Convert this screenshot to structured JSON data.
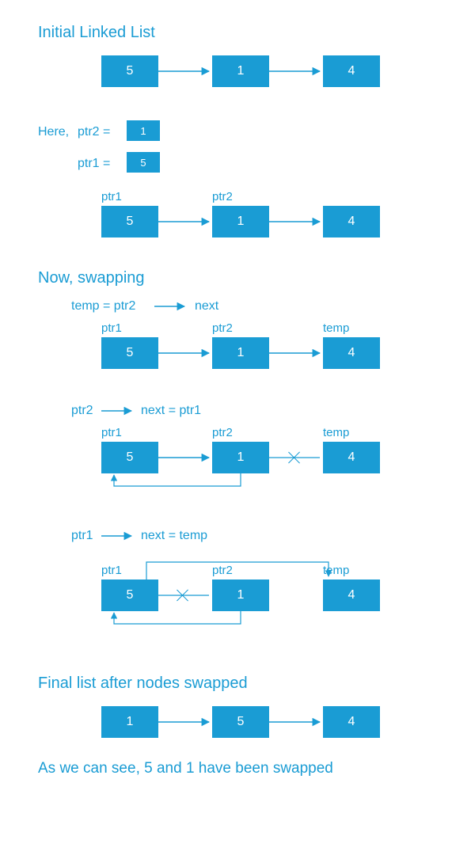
{
  "colors": {
    "accent": "#1a9cd4"
  },
  "heading_initial": "Initial Linked List",
  "here_label": "Here,",
  "ptr2_eq": "ptr2  =",
  "ptr1_eq": "ptr1  =",
  "ptr1_label": "ptr1",
  "ptr2_label": "ptr2",
  "temp_label": "temp",
  "heading_swapping": "Now,   swapping",
  "expr_temp": "temp  =  ptr2",
  "expr_temp_tail": "next",
  "expr_ptr2": "ptr2",
  "expr_ptr2_tail": "next  =  ptr1",
  "expr_ptr1": "ptr1",
  "expr_ptr1_tail": "next  =  temp",
  "heading_final": "Final list after nodes swapped",
  "conclusion": "As we can see,  5 and 1 have been swapped",
  "nodes": {
    "initial": [
      "5",
      "1",
      "4"
    ],
    "small_ptr2": "1",
    "small_ptr1": "5",
    "row_labeled": [
      "5",
      "1",
      "4"
    ],
    "row_temp": [
      "5",
      "1",
      "4"
    ],
    "row_ptr2next": [
      "5",
      "1",
      "4"
    ],
    "row_ptr1next": [
      "5",
      "1",
      "4"
    ],
    "final": [
      "1",
      "5",
      "4"
    ]
  }
}
